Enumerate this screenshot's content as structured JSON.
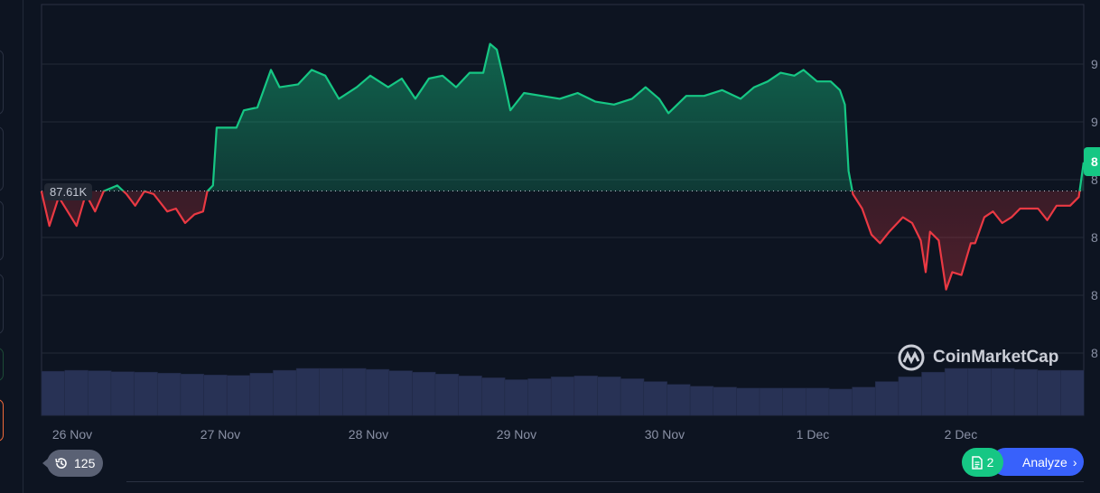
{
  "chart_data": {
    "type": "area",
    "title": "",
    "reference_price_label": "87.61K",
    "reference_price": 87.61,
    "current_price_label": "8",
    "x_unit": "hours since 26 Nov 00:00",
    "y_unit": "K USD",
    "ylim": [
      81,
      94
    ],
    "y_gridlines": [
      92,
      90,
      88,
      86,
      84,
      82
    ],
    "y_tick_labels": [
      "9",
      "9",
      "8",
      "8",
      "8",
      "8"
    ],
    "x_ticks": [
      {
        "label": "26 Nov",
        "hour": 0
      },
      {
        "label": "27 Nov",
        "hour": 24
      },
      {
        "label": "28 Nov",
        "hour": 48
      },
      {
        "label": "29 Nov",
        "hour": 72
      },
      {
        "label": "30 Nov",
        "hour": 96
      },
      {
        "label": "1 Dec",
        "hour": 120
      },
      {
        "label": "2 Dec",
        "hour": 144
      }
    ],
    "colors": {
      "up": "#16c784",
      "down": "#ea3943",
      "volume": "#283255"
    },
    "price": [
      [
        -5.0,
        87.6
      ],
      [
        -3.7,
        86.4
      ],
      [
        -2.2,
        87.4
      ],
      [
        0.7,
        86.4
      ],
      [
        2.2,
        87.5
      ],
      [
        3.7,
        86.9
      ],
      [
        5.1,
        87.6
      ],
      [
        7.3,
        87.8
      ],
      [
        8.8,
        87.5
      ],
      [
        10.2,
        87.1
      ],
      [
        11.7,
        87.6
      ],
      [
        13.2,
        87.5
      ],
      [
        15.4,
        86.9
      ],
      [
        16.8,
        87.0
      ],
      [
        18.3,
        86.5
      ],
      [
        19.8,
        86.8
      ],
      [
        21.2,
        86.9
      ],
      [
        21.9,
        87.6
      ],
      [
        22.8,
        87.8
      ],
      [
        23.4,
        89.8
      ],
      [
        24.9,
        89.8
      ],
      [
        26.6,
        89.8
      ],
      [
        27.8,
        90.4
      ],
      [
        30.0,
        90.5
      ],
      [
        32.2,
        91.8
      ],
      [
        33.6,
        91.2
      ],
      [
        36.6,
        91.3
      ],
      [
        38.8,
        91.8
      ],
      [
        41.0,
        91.6
      ],
      [
        43.2,
        90.8
      ],
      [
        46.1,
        91.2
      ],
      [
        48.3,
        91.6
      ],
      [
        51.2,
        91.2
      ],
      [
        53.4,
        91.5
      ],
      [
        55.6,
        90.8
      ],
      [
        57.8,
        91.5
      ],
      [
        60.0,
        91.6
      ],
      [
        62.2,
        91.2
      ],
      [
        64.4,
        91.7
      ],
      [
        66.6,
        91.7
      ],
      [
        67.7,
        92.7
      ],
      [
        68.8,
        92.5
      ],
      [
        69.9,
        91.5
      ],
      [
        71.0,
        90.4
      ],
      [
        73.2,
        91.0
      ],
      [
        76.1,
        90.9
      ],
      [
        79.0,
        90.8
      ],
      [
        81.9,
        91.0
      ],
      [
        84.8,
        90.7
      ],
      [
        87.8,
        90.6
      ],
      [
        90.7,
        90.8
      ],
      [
        92.9,
        91.2
      ],
      [
        95.1,
        90.8
      ],
      [
        96.6,
        90.3
      ],
      [
        99.5,
        90.9
      ],
      [
        102.4,
        90.9
      ],
      [
        105.3,
        91.1
      ],
      [
        108.3,
        90.8
      ],
      [
        110.5,
        91.2
      ],
      [
        112.7,
        91.4
      ],
      [
        114.8,
        91.7
      ],
      [
        117.0,
        91.6
      ],
      [
        118.5,
        91.8
      ],
      [
        120.7,
        91.4
      ],
      [
        122.9,
        91.4
      ],
      [
        124.4,
        91.1
      ],
      [
        125.2,
        90.6
      ],
      [
        125.8,
        88.3
      ],
      [
        126.5,
        87.5
      ],
      [
        128.0,
        87.0
      ],
      [
        129.5,
        86.1
      ],
      [
        130.9,
        85.8
      ],
      [
        132.4,
        86.2
      ],
      [
        134.6,
        86.7
      ],
      [
        136.1,
        86.5
      ],
      [
        137.5,
        85.9
      ],
      [
        138.3,
        84.8
      ],
      [
        139.0,
        86.2
      ],
      [
        140.4,
        85.9
      ],
      [
        141.6,
        84.2
      ],
      [
        142.6,
        84.8
      ],
      [
        144.1,
        84.7
      ],
      [
        145.6,
        85.8
      ],
      [
        146.3,
        85.8
      ],
      [
        147.8,
        86.7
      ],
      [
        149.2,
        86.9
      ],
      [
        150.7,
        86.5
      ],
      [
        152.2,
        86.7
      ],
      [
        153.6,
        87.0
      ],
      [
        156.5,
        87.0
      ],
      [
        158.0,
        86.6
      ],
      [
        159.5,
        87.1
      ],
      [
        161.7,
        87.1
      ],
      [
        163.1,
        87.4
      ],
      [
        163.9,
        88.6
      ]
    ],
    "volume_relative": [
      0.94,
      0.96,
      0.95,
      0.93,
      0.92,
      0.9,
      0.88,
      0.86,
      0.85,
      0.9,
      0.96,
      1.0,
      1.0,
      1.0,
      0.98,
      0.95,
      0.92,
      0.88,
      0.84,
      0.8,
      0.76,
      0.78,
      0.82,
      0.84,
      0.82,
      0.78,
      0.72,
      0.66,
      0.62,
      0.6,
      0.58,
      0.58,
      0.58,
      0.58,
      0.56,
      0.6,
      0.72,
      0.82,
      0.92,
      1.0,
      1.0,
      1.0,
      0.98,
      0.96,
      0.96
    ]
  },
  "watermark": "CoinMarketCap",
  "history_count": "125",
  "notes_count": "2",
  "analyze_label": "Analyze"
}
